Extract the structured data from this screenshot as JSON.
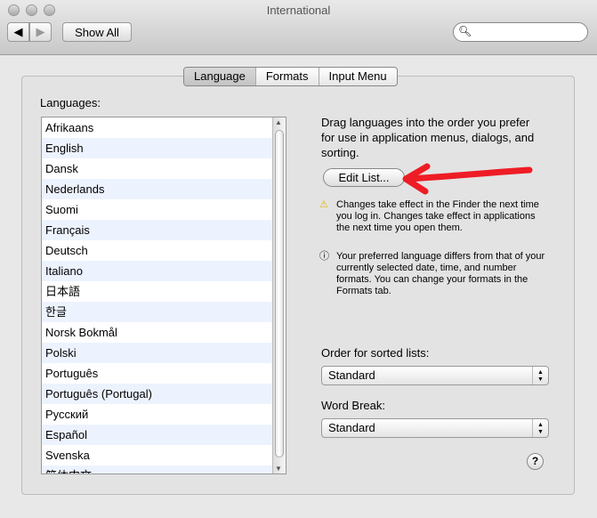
{
  "window": {
    "title": "International"
  },
  "toolbar": {
    "back": "◀",
    "forward": "▶",
    "show_all": "Show All",
    "search_placeholder": ""
  },
  "tabs": [
    {
      "label": "Language",
      "active": true
    },
    {
      "label": "Formats"
    },
    {
      "label": "Input Menu"
    }
  ],
  "languages": {
    "label": "Languages:",
    "items": [
      "Afrikaans",
      "English",
      "Dansk",
      "Nederlands",
      "Suomi",
      "Français",
      "Deutsch",
      "Italiano",
      "日本語",
      "한글",
      "Norsk Bokmål",
      "Polski",
      "Português",
      "Português (Portugal)",
      "Русский",
      "Español",
      "Svenska",
      "简体中文"
    ]
  },
  "description": "Drag languages into the order you prefer for use in application menus, dialogs, and sorting.",
  "edit_list": "Edit List...",
  "notes": {
    "warning": "Changes take effect in the Finder the next time you log in. Changes take effect in applications the next time you open them.",
    "info": "Your preferred language differs from that of your currently selected date, time, and number formats. You can change your formats in the Formats tab."
  },
  "sorted": {
    "label": "Order for sorted lists:",
    "value": "Standard"
  },
  "word_break": {
    "label": "Word Break:",
    "value": "Standard"
  },
  "help": "?",
  "annotation_color": "#ee1c25"
}
